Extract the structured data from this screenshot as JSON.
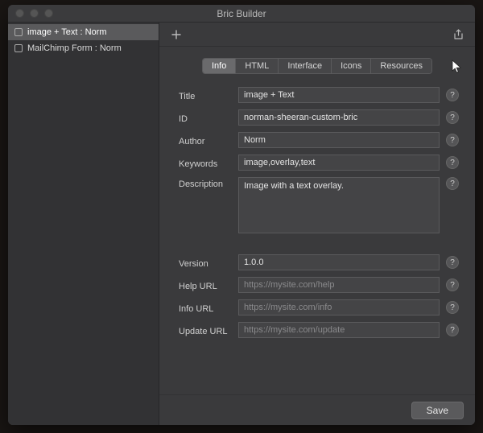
{
  "window": {
    "title": "Bric Builder"
  },
  "sidebar": {
    "items": [
      {
        "label": "image + Text : Norm",
        "active": true
      },
      {
        "label": "MailChimp Form : Norm",
        "active": false
      }
    ]
  },
  "toolbar": {
    "add": "+",
    "share": "share"
  },
  "tabs": {
    "items": [
      "Info",
      "HTML",
      "Interface",
      "Icons",
      "Resources"
    ],
    "active": 0
  },
  "form": {
    "title": {
      "label": "Title",
      "value": "image + Text"
    },
    "id": {
      "label": "ID",
      "value": "norman-sheeran-custom-bric"
    },
    "author": {
      "label": "Author",
      "value": "Norm"
    },
    "keywords": {
      "label": "Keywords",
      "value": "image,overlay,text"
    },
    "description": {
      "label": "Description",
      "value": "Image with a text overlay."
    },
    "version": {
      "label": "Version",
      "value": "1.0.0"
    },
    "help_url": {
      "label": "Help URL",
      "placeholder": "https://mysite.com/help"
    },
    "info_url": {
      "label": "Info URL",
      "placeholder": "https://mysite.com/info"
    },
    "update_url": {
      "label": "Update URL",
      "placeholder": "https://mysite.com/update"
    }
  },
  "footer": {
    "save": "Save"
  }
}
